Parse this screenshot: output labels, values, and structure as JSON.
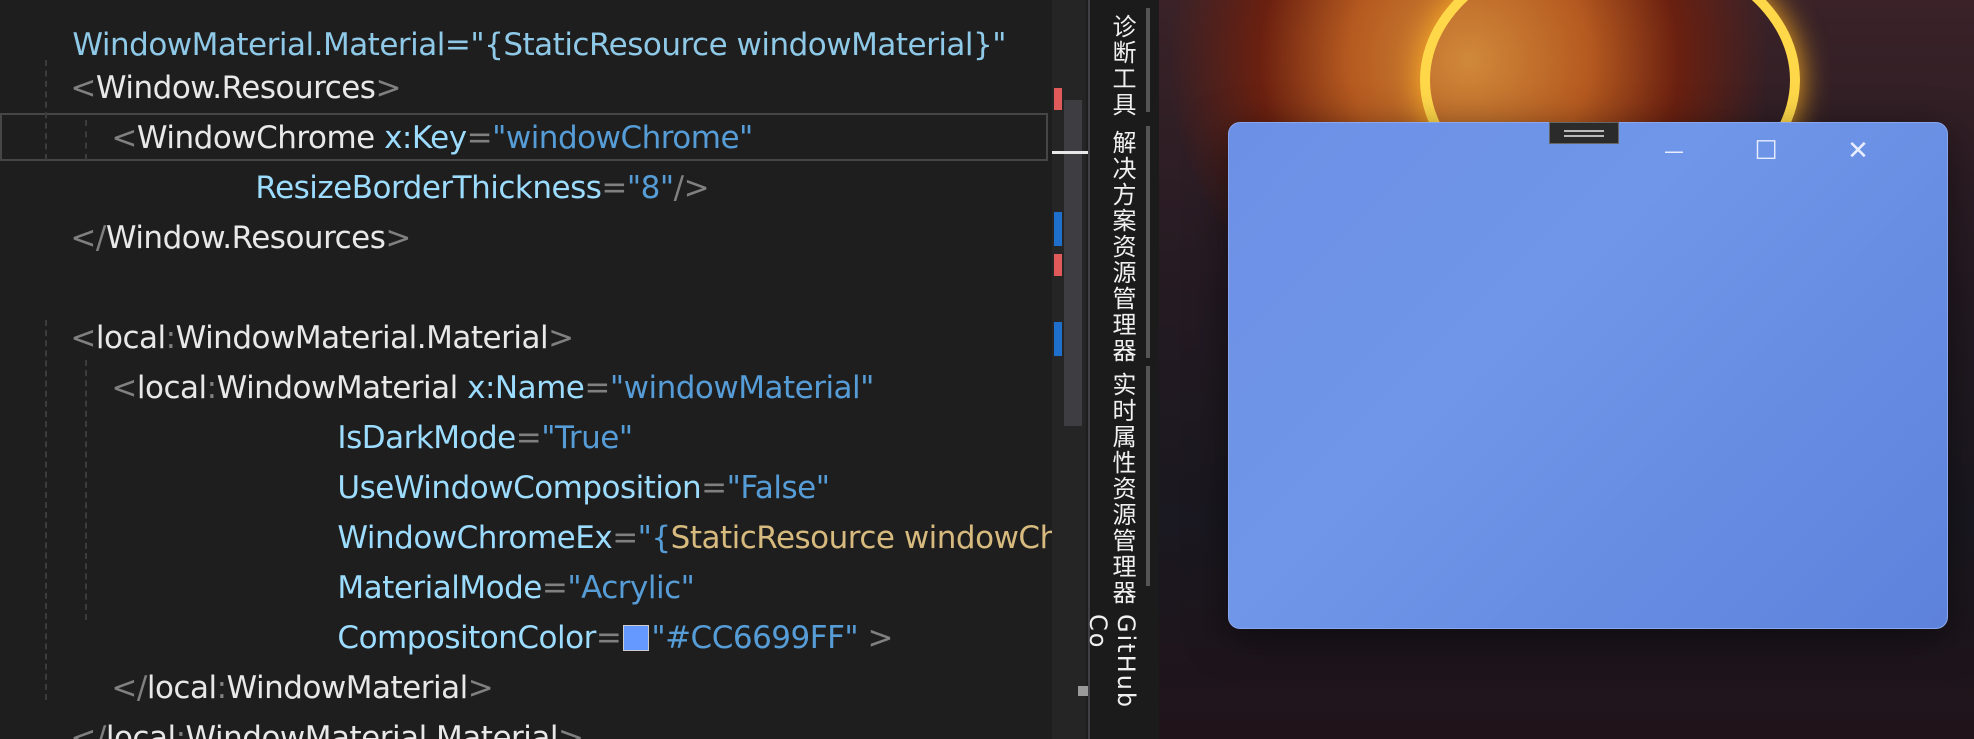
{
  "editor": {
    "lines": {
      "l0": {
        "text": "<Window.Resources>"
      },
      "l1": {
        "open": "<",
        "el": "WindowChrome",
        "attr1": " x:Key",
        "eq": "=",
        "val1": "\"windowChrome\""
      },
      "l2": {
        "attr": "ResizeBorderThickness",
        "eq": "=",
        "val": "\"8\"",
        "close": "/>"
      },
      "l3": {
        "text": "</Window.Resources>"
      },
      "l5": {
        "open": "<",
        "ns": "local",
        "colon": ":",
        "el": "WindowMaterial.Material",
        "close": ">"
      },
      "l6": {
        "open": "<",
        "ns": "local",
        "colon": ":",
        "el": "WindowMaterial",
        "attr": " x:Name",
        "eq": "=",
        "val": "\"windowMaterial\""
      },
      "l7": {
        "attr": "IsDarkMode",
        "eq": "=",
        "val": "\"True\""
      },
      "l8": {
        "attr": "UseWindowComposition",
        "eq": "=",
        "val": "\"False\""
      },
      "l9": {
        "attr": "WindowChromeEx",
        "eq": "=",
        "q": "\"{",
        "res": "StaticResource",
        "resval": " windowChr"
      },
      "l10": {
        "attr": "MaterialMode",
        "eq": "=",
        "val": "\"Acrylic\""
      },
      "l11": {
        "attr": "CompositonColor",
        "eq": "=",
        "val": "\"#CC6699FF\"",
        "close": " >"
      },
      "l12": {
        "open": "</",
        "ns": "local",
        "colon": ":",
        "el": "WindowMaterial",
        "close": ">"
      },
      "l13": {
        "open": "</",
        "ns": "local",
        "colon": ":",
        "el": "WindowMaterial.Material",
        "close": ">"
      }
    },
    "swatch_color": "#6699FF"
  },
  "side_tabs": {
    "diagnostics": "诊断工具",
    "solution_explorer": "解决方案资源管理器",
    "live_property_explorer": "实时属性资源管理器",
    "github_copilot": "GitHub Co"
  },
  "acrylic_window": {
    "minimize": "—",
    "maximize": "☐",
    "close": "✕",
    "tint_color": "#6C90E6"
  }
}
